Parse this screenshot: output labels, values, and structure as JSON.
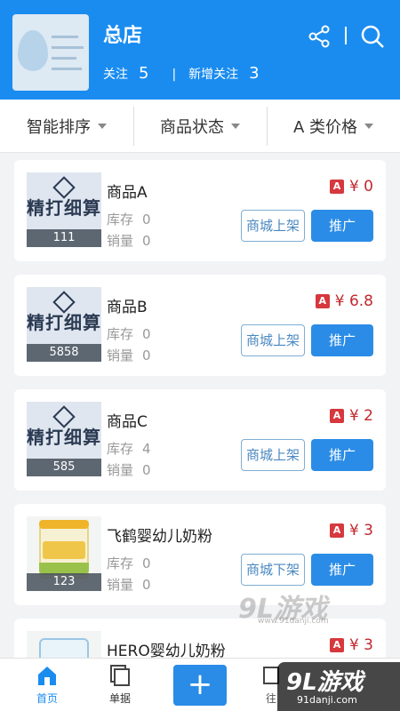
{
  "header": {
    "shop_name": "总店",
    "follow_label": "关注",
    "follow_count": "5",
    "separator": "|",
    "new_follow_label": "新增关注",
    "new_follow_count": "3"
  },
  "filters": [
    {
      "label": "智能排序"
    },
    {
      "label": "商品状态"
    },
    {
      "label": "A 类价格"
    }
  ],
  "products": [
    {
      "name": "商品A",
      "badge": "A",
      "price": "¥ 0",
      "stock_label": "库存",
      "stock": "0",
      "sales_label": "销量",
      "sales": "0",
      "count": "111",
      "thumb_text": "精打细算",
      "shelf_label": "商城上架",
      "promote_label": "推广"
    },
    {
      "name": "商品B",
      "badge": "A",
      "price": "¥ 6.8",
      "stock_label": "库存",
      "stock": "0",
      "sales_label": "销量",
      "sales": "0",
      "count": "5858",
      "thumb_text": "精打细算",
      "shelf_label": "商城上架",
      "promote_label": "推广"
    },
    {
      "name": "商品C",
      "badge": "A",
      "price": "¥ 2",
      "stock_label": "库存",
      "stock": "4",
      "sales_label": "销量",
      "sales": "0",
      "count": "585",
      "thumb_text": "精打细算",
      "shelf_label": "商城上架",
      "promote_label": "推广"
    },
    {
      "name": "飞鹤婴幼儿奶粉",
      "badge": "A",
      "price": "¥ 3",
      "stock_label": "库存",
      "stock": "0",
      "sales_label": "销量",
      "sales": "0",
      "count": "123",
      "shelf_label": "商城下架",
      "promote_label": "推广"
    },
    {
      "name": "HERO婴幼儿奶粉",
      "badge": "A",
      "price": "¥ 3"
    }
  ],
  "tabbar": {
    "home": "首页",
    "orders": "单据",
    "add": "+",
    "partial": "往"
  },
  "watermark": {
    "logo": "9L游戏",
    "small_url": "www.91danji.com",
    "badge_url": "91danji.com"
  },
  "colors": {
    "primary": "#1a8cf0",
    "price_red": "#c0282d"
  }
}
